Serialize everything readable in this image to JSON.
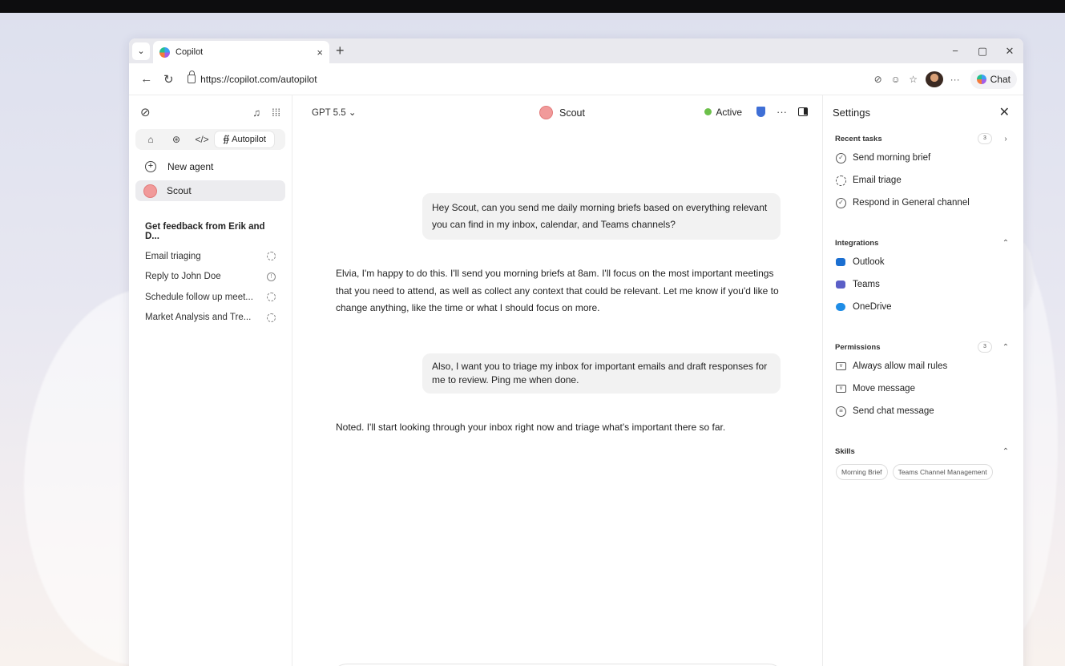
{
  "browser": {
    "tab_title": "Copilot",
    "tab_close": "×",
    "new_tab": "+",
    "url": "https://copilot.com/autopilot",
    "chat_button": "Chat",
    "more": "···",
    "win_minimize": "−",
    "win_maximize": "▢",
    "win_close": "✕"
  },
  "sidebar": {
    "mode_autopilot": "Autopilot",
    "new_agent": "New agent",
    "agent_name": "Scout",
    "group_title": "Get feedback from Erik and D...",
    "tasks": [
      {
        "label": "Email triaging",
        "status": "pending"
      },
      {
        "label": "Reply to John Doe",
        "status": "info"
      },
      {
        "label": "Schedule follow up meet...",
        "status": "pending"
      },
      {
        "label": "Market Analysis and Tre...",
        "status": "pending"
      }
    ]
  },
  "chat": {
    "model": "GPT 5.5",
    "agent_name": "Scout",
    "status": "Active",
    "messages": [
      {
        "role": "user",
        "text": "Hey Scout, can you send me daily morning briefs based on everything relevant you can find in my inbox, calendar, and Teams channels?"
      },
      {
        "role": "assistant",
        "text": "Elvia, I'm happy to do this. I'll send you morning briefs at 8am. I'll focus on the most important meetings that you need to attend, as well as collect any context that could be relevant. Let me know if you'd like to change anything, like the time or what I should focus on more."
      },
      {
        "role": "user",
        "text": "Also, I want you to triage my inbox for important emails and draft responses for me to review. Ping me when done."
      },
      {
        "role": "assistant",
        "text": "Noted. I'll start looking through your inbox right now and triage what's important there so far."
      }
    ]
  },
  "settings": {
    "title": "Settings",
    "recent_tasks": {
      "title": "Recent tasks",
      "count": "3",
      "items": [
        "Send morning brief",
        "Email triage",
        "Respond in General channel"
      ]
    },
    "integrations": {
      "title": "Integrations",
      "items": [
        {
          "label": "Outlook",
          "color": "#1b6fd1"
        },
        {
          "label": "Teams",
          "color": "#5b5fc7"
        },
        {
          "label": "OneDrive",
          "color": "#1f8de6"
        }
      ]
    },
    "permissions": {
      "title": "Permissions",
      "count": "3",
      "items": [
        "Always allow mail rules",
        "Move message",
        "Send chat message"
      ]
    },
    "skills": {
      "title": "Skills",
      "items": [
        "Morning Brief",
        "Teams Channel Management"
      ]
    }
  },
  "colors": {
    "active_status": "#6cc04a",
    "shield": "#3f6fd6",
    "agent_avatar": "#f19a9a"
  }
}
